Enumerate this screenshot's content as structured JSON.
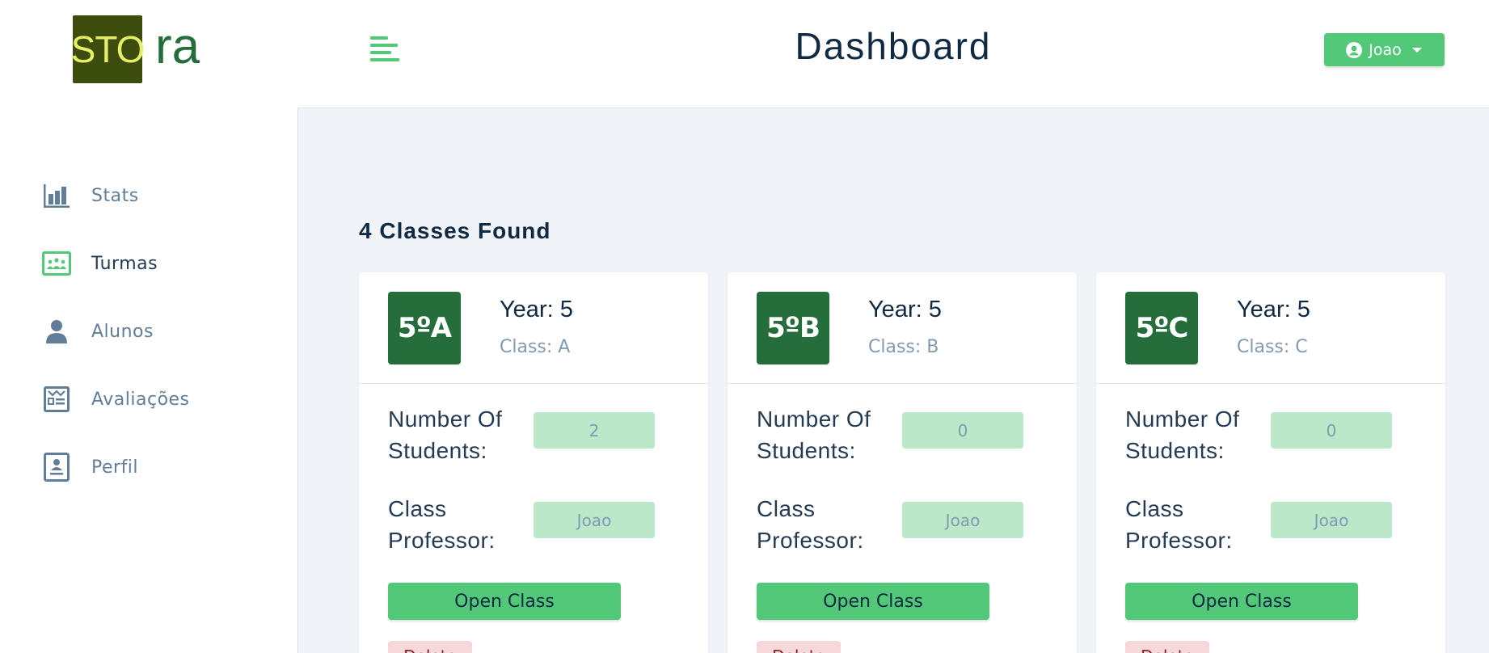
{
  "logo": {
    "boxed": "STO",
    "rest": "ra"
  },
  "sidebar": {
    "items": [
      {
        "label": "Stats",
        "icon": "bar-chart-icon",
        "active": false
      },
      {
        "label": "Turmas",
        "icon": "classroom-icon",
        "active": true
      },
      {
        "label": "Alunos",
        "icon": "user-icon",
        "active": false
      },
      {
        "label": "Avaliações",
        "icon": "clipboard-icon",
        "active": false
      },
      {
        "label": "Perfil",
        "icon": "profile-card-icon",
        "active": false
      }
    ]
  },
  "header": {
    "title": "Dashboard",
    "user": {
      "name": "Joao",
      "icon": "user-circle-icon",
      "caret": "caret-down-icon"
    }
  },
  "main": {
    "found_text": "4 Classes Found",
    "cards": [
      {
        "badge": "5ºA",
        "year": "Year: 5",
        "class_label": "Class: A",
        "students_label": "Number Of Students:",
        "students": "2",
        "professor_label": "Class Professor:",
        "professor": "Joao",
        "open_label": "Open Class",
        "delete_label": "Delete"
      },
      {
        "badge": "5ºB",
        "year": "Year: 5",
        "class_label": "Class: B",
        "students_label": "Number Of Students:",
        "students": "0",
        "professor_label": "Class Professor:",
        "professor": "Joao",
        "open_label": "Open Class",
        "delete_label": "Delete"
      },
      {
        "badge": "5ºC",
        "year": "Year: 5",
        "class_label": "Class: C",
        "students_label": "Number Of Students:",
        "students": "0",
        "professor_label": "Class Professor:",
        "professor": "Joao",
        "open_label": "Open Class",
        "delete_label": "Delete"
      }
    ]
  },
  "colors": {
    "accent": "#52c878",
    "badge": "#256d3a",
    "value_bg": "#bbe8c9",
    "delete_bg": "#f8d7da",
    "main_bg": "#f0f4f8"
  }
}
